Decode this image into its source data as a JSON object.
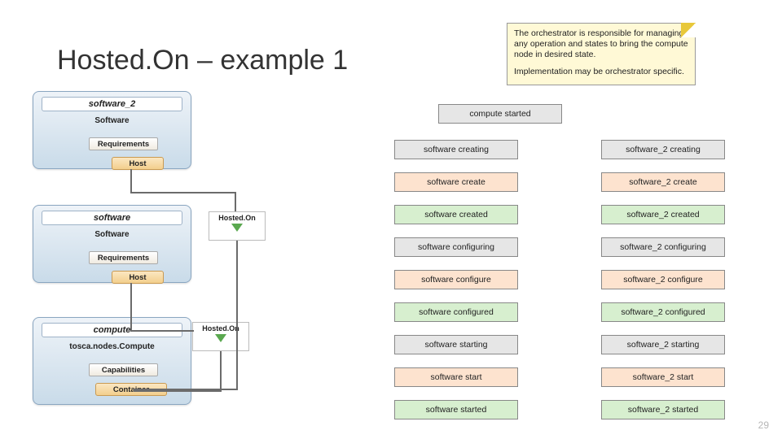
{
  "title": "Hosted.On – example 1",
  "page_number": "29",
  "note": {
    "p1": "The orchestrator is responsible for managing any operation and states to bring the compute node in desired state.",
    "p2": "Implementation may be orchestrator specific."
  },
  "nodes": {
    "n1": {
      "name": "software_2",
      "type": "Software",
      "requirements": "Requirements",
      "host": "Host"
    },
    "n2": {
      "name": "software",
      "type": "Software",
      "requirements": "Requirements",
      "host": "Host"
    },
    "n3": {
      "name": "compute",
      "type": "tosca.nodes.Compute",
      "capabilities": "Capabilities",
      "container": "Container"
    }
  },
  "rel": {
    "label": "Hosted.On"
  },
  "header": "compute started",
  "rows": [
    {
      "c1": "software creating",
      "c2": "software_2 creating",
      "style": "gray"
    },
    {
      "c1": "software create",
      "c2": "software_2 create",
      "style": "peach"
    },
    {
      "c1": "software created",
      "c2": "software_2 created",
      "style": "green"
    },
    {
      "c1": "software configuring",
      "c2": "software_2 configuring",
      "style": "gray"
    },
    {
      "c1": "software configure",
      "c2": "software_2 configure",
      "style": "peach"
    },
    {
      "c1": "software configured",
      "c2": "software_2 configured",
      "style": "green"
    },
    {
      "c1": "software starting",
      "c2": "software_2 starting",
      "style": "gray"
    },
    {
      "c1": "software start",
      "c2": "software_2 start",
      "style": "peach"
    },
    {
      "c1": "software started",
      "c2": "software_2 started",
      "style": "green"
    }
  ]
}
